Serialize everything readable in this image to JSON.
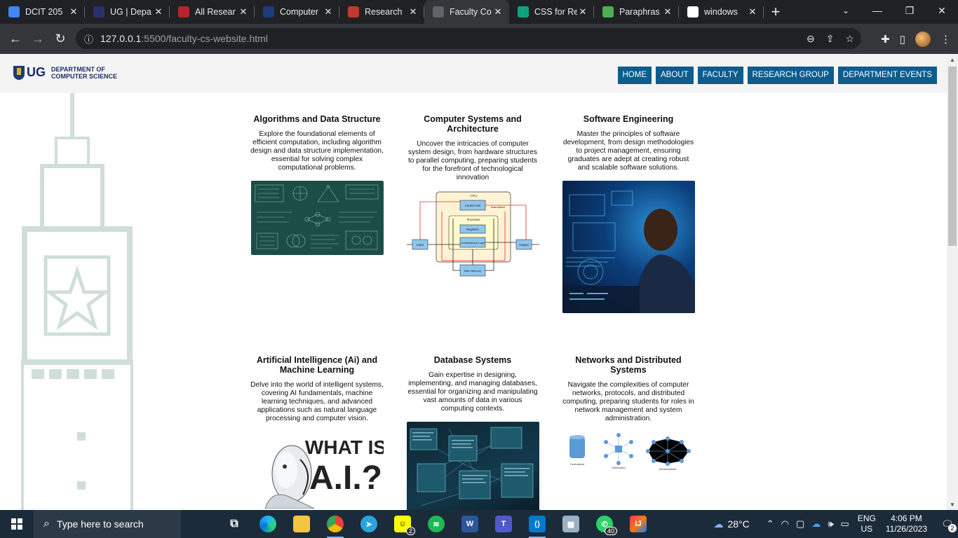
{
  "browser": {
    "tabs": [
      {
        "title": "DCIT 205",
        "icon": "docs-icon",
        "color": "#4285f4"
      },
      {
        "title": "UG | Depa",
        "icon": "ug-icon",
        "color": "#2a2f6b"
      },
      {
        "title": "All Resear",
        "icon": "shield-icon",
        "color": "#b3262b"
      },
      {
        "title": "Computer",
        "icon": "shield-icon",
        "color": "#1f3a7a"
      },
      {
        "title": "Research",
        "icon": "shield-icon",
        "color": "#c0392b"
      },
      {
        "title": "Faculty Co",
        "icon": "globe-icon",
        "color": "#5f6368"
      },
      {
        "title": "CSS for Re",
        "icon": "chatgpt-icon",
        "color": "#10a37f"
      },
      {
        "title": "Paraphras",
        "icon": "bot-icon",
        "color": "#4caf50"
      },
      {
        "title": "windows",
        "icon": "google-icon",
        "color": "#ffffff"
      }
    ],
    "url_host": "127.0.0.1",
    "url_rest": ":5500/faculty-cs-website.html"
  },
  "site": {
    "logo_ug": "UG",
    "logo_dept_line1": "DEPARTMENT OF",
    "logo_dept_line2": "COMPUTER SCIENCE",
    "nav": [
      "HOME",
      "ABOUT",
      "FACULTY",
      "RESEARCH GROUP",
      "DEPARTMENT EVENTS"
    ],
    "accent_color": "#0d5c8c"
  },
  "cards": [
    {
      "title": "Algorithms and Data Structure",
      "text": "Explore the foundational elements of efficient computation, including algorithm design and data structure implementation, essential for solving complex computational problems."
    },
    {
      "title": "Computer Systems and Architecture",
      "text": "Uncover the intricacies of computer system design, from hardware structures to parallel computing, preparing students for the forefront of technological innovation"
    },
    {
      "title": "Software Engineering",
      "text": "Master the principles of software development, from design methodologies to project management, ensuring graduates are adept at creating robust and scalable software solutions."
    },
    {
      "title": "Artificial Intelligence (Ai) and Machine Learning",
      "text": "Delve into the world of intelligent systems, covering AI fundamentals, machine learning techniques, and advanced applications such as natural language processing and computer vision."
    },
    {
      "title": "Database Systems",
      "text": "Gain expertise in designing, implementing, and managing databases, essential for organizing and manipulating vast amounts of data in various computing contexts."
    },
    {
      "title": "Networks and Distributed Systems",
      "text": "Navigate the complexities of computer networks, protocols, and distributed computing, preparing students for roles in network management and system administration."
    }
  ],
  "diagram_labels": {
    "cpu": "CPU",
    "control_unit": "Control Unit",
    "instructions": "Instructions",
    "processor": "Processor",
    "registers": "Registers",
    "alu": "Combinational Logic",
    "input": "Input",
    "output": "Output",
    "memory": "Main Memory"
  },
  "ai_image_text": "WHAT IS A.I.?",
  "network_labels": [
    "Centralized",
    "Distributed",
    "Decentralized"
  ],
  "taskbar": {
    "search_placeholder": "Type here to search",
    "weather": "28°C",
    "lang_line1": "ENG",
    "lang_line2": "US",
    "time": "4:06 PM",
    "date": "11/26/2023",
    "notif_count": "2",
    "snapchat_badge": "2",
    "whatsapp_badge": "40"
  }
}
